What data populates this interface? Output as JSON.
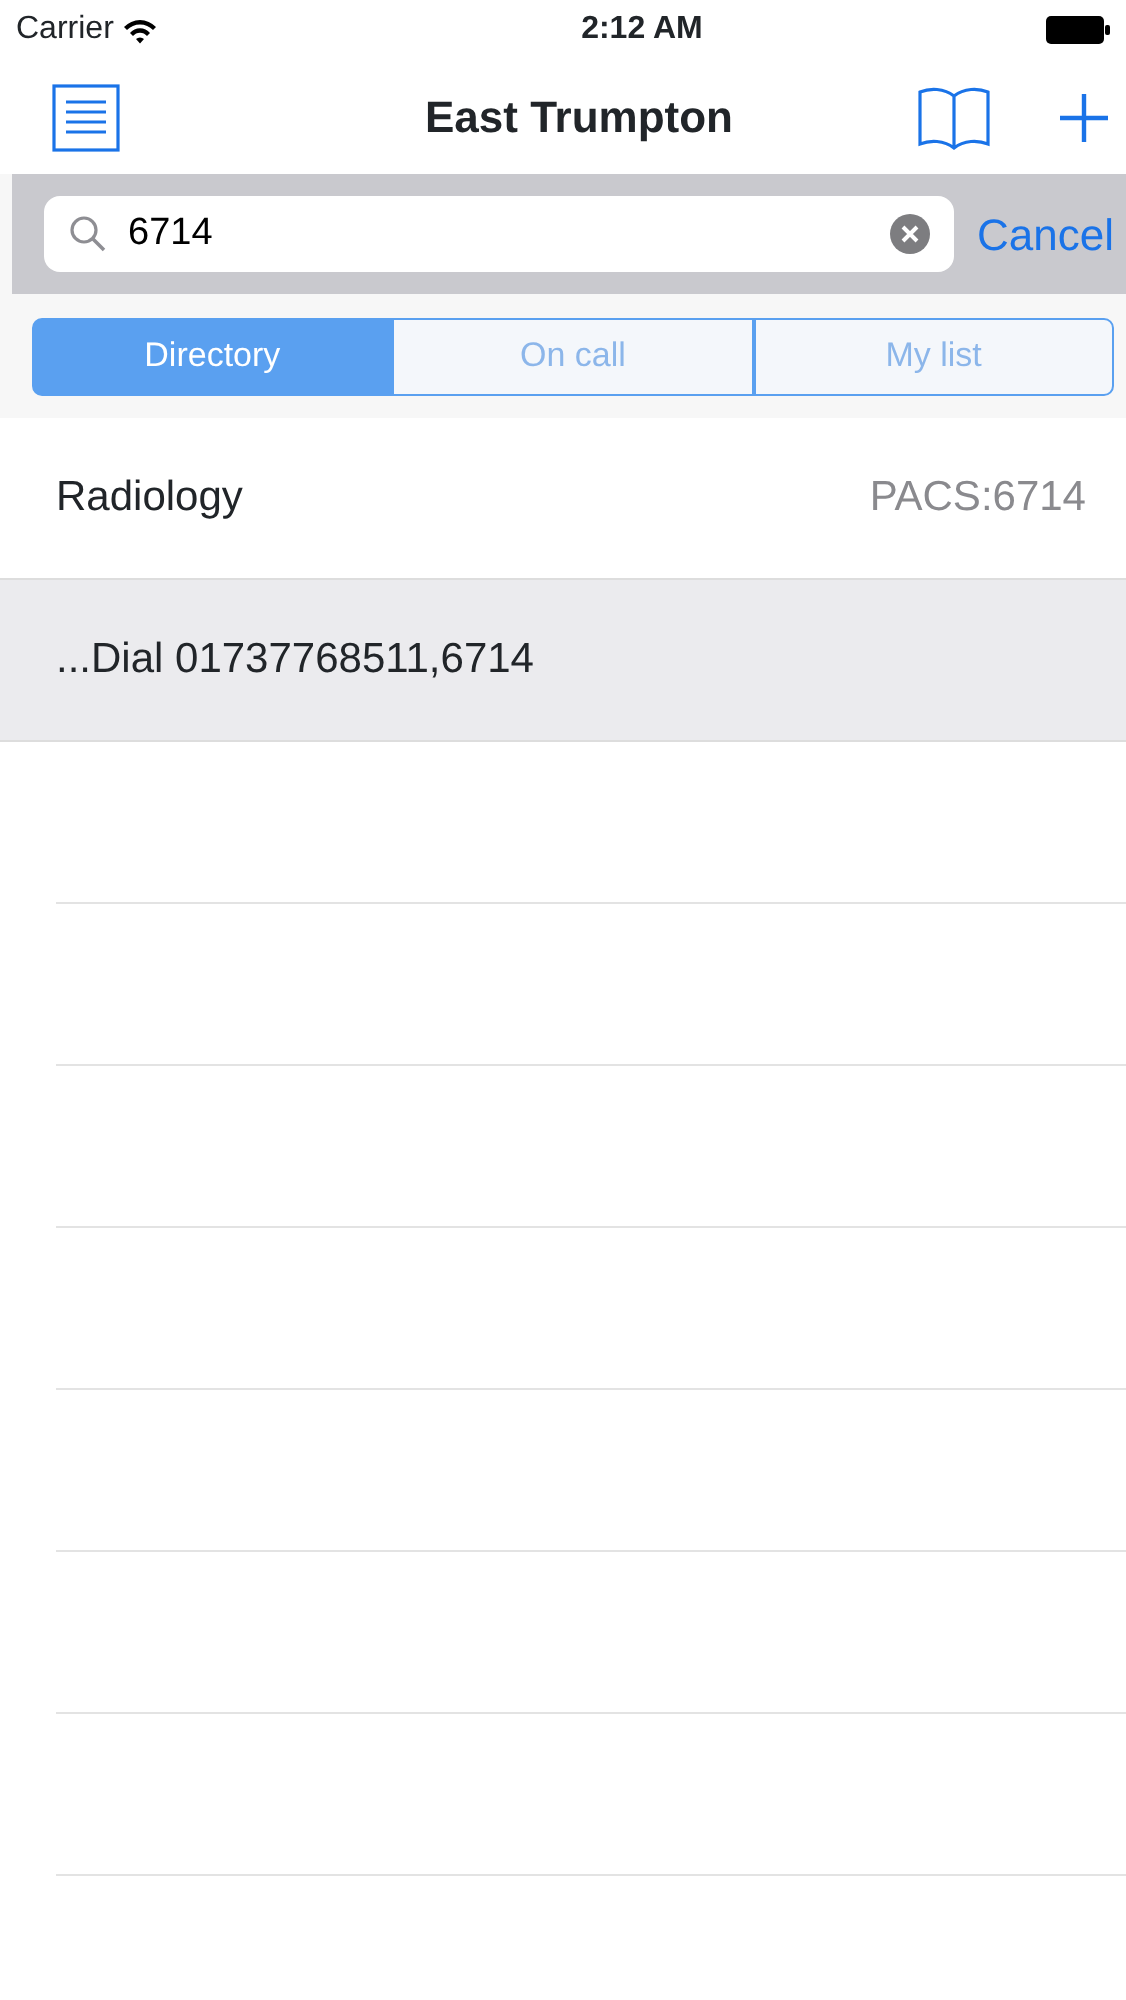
{
  "status_bar": {
    "carrier": "Carrier",
    "time": "2:12 AM"
  },
  "nav_bar": {
    "title": "East Trumpton"
  },
  "search": {
    "value": "6714",
    "cancel": "Cancel"
  },
  "segments": [
    {
      "label": "Directory",
      "selected": true
    },
    {
      "label": "On call",
      "selected": false
    },
    {
      "label": "My list",
      "selected": false
    }
  ],
  "results": [
    {
      "title": "Radiology",
      "detail": "PACS:6714",
      "selected": false
    },
    {
      "title": "...Dial 01737768511,6714",
      "selected": true
    }
  ]
}
